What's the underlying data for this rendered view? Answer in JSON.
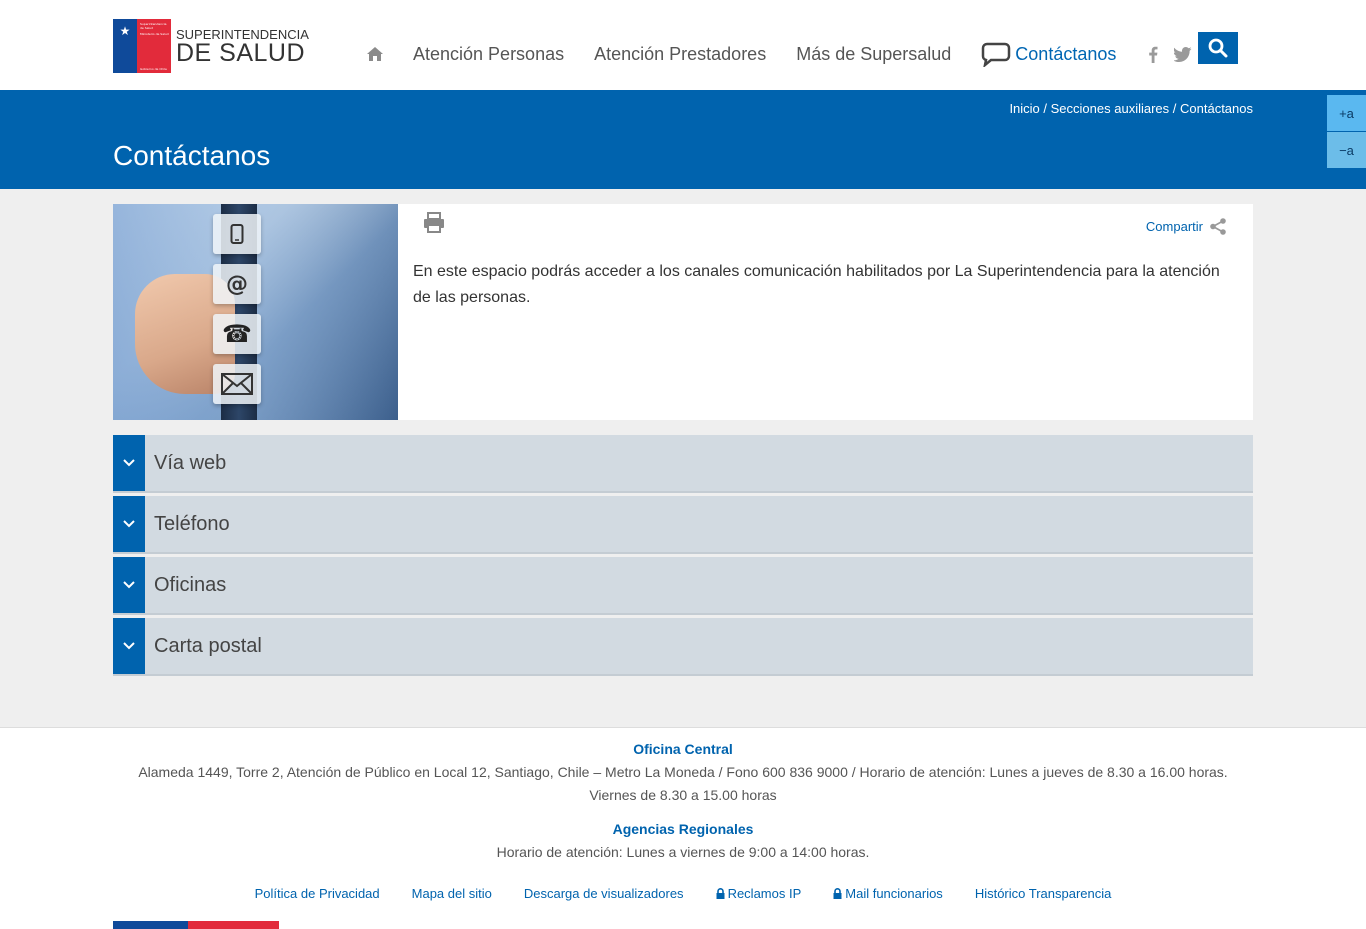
{
  "header": {
    "logo_line1": "SUPERINTENDENCIA",
    "logo_line2": "DE SALUD",
    "logo_flag_text1": "Superintendencia",
    "logo_flag_text2": "de Salud",
    "logo_flag_text3": "Ministerio de Salud",
    "logo_flag_text4": "Gobierno de Chile",
    "nav": {
      "item1": "Atención Personas",
      "item2": "Atención Prestadores",
      "item3": "Más de Supersalud",
      "contact": "Contáctanos"
    }
  },
  "bluebar": {
    "breadcrumb": {
      "home": "Inicio",
      "sep1": " / ",
      "section": "Secciones auxiliares",
      "sep2": " / ",
      "current": "Contáctanos"
    },
    "title": "Contáctanos"
  },
  "font_controls": {
    "increase": "+a",
    "decrease": "−a"
  },
  "intro": {
    "share_label": "Compartir",
    "text": "En este espacio podrás acceder a los canales comunicación habilitados por La Superintendencia para la atención de las personas."
  },
  "accordion": [
    {
      "label": "Vía web"
    },
    {
      "label": "Teléfono"
    },
    {
      "label": "Oficinas"
    },
    {
      "label": "Carta postal"
    }
  ],
  "footer": {
    "central_heading": "Oficina Central",
    "central_line1": "Alameda 1449, Torre 2, Atención de Público en Local 12, Santiago, Chile – Metro La Moneda / Fono 600 836 9000 / Horario de atención: Lunes a jueves de 8.30 a 16.00 horas.",
    "central_line2": "Viernes de 8.30 a 15.00 horas",
    "regional_heading": "Agencias Regionales",
    "regional_line": "Horario de atención: Lunes a viernes de 9:00 a 14:00 horas.",
    "links": {
      "privacy": "Política de Privacidad",
      "sitemap": "Mapa del sitio",
      "viewers": "Descarga de visualizadores",
      "claims": "Reclamos IP",
      "mail": "Mail funcionarios",
      "history": "Histórico Transparencia"
    }
  },
  "colors": {
    "primary_blue": "#0063ae",
    "accordion_bg": "#d2dae1",
    "gov_blue": "#0f4a9a",
    "gov_red": "#e22b3b"
  }
}
